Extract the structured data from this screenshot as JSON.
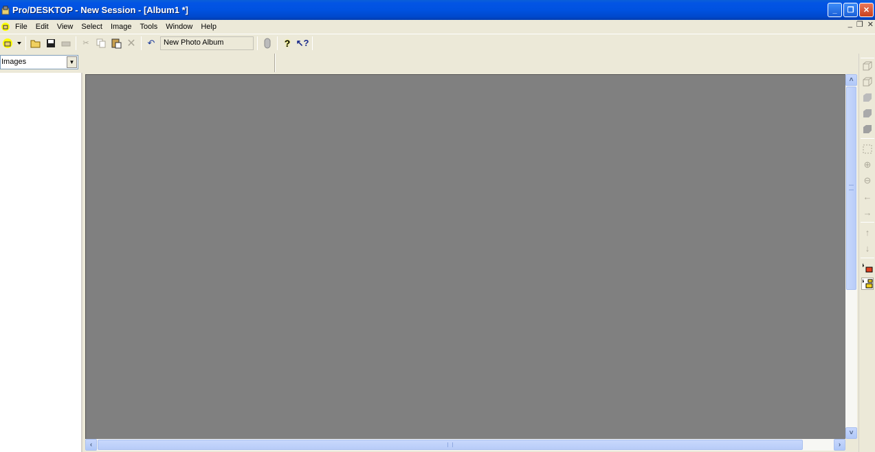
{
  "window": {
    "title": "Pro/DESKTOP - New Session - [Album1 *]",
    "minimize": "_",
    "restore": "❐",
    "close": "✕"
  },
  "menubar": {
    "items": [
      "File",
      "Edit",
      "View",
      "Select",
      "Image",
      "Tools",
      "Window",
      "Help"
    ],
    "mdi": {
      "minimize": "_",
      "restore": "❐",
      "close": "✕"
    }
  },
  "toolbar": {
    "field_value": "New Photo Album",
    "icons": [
      "app-menu-icon",
      "dropdown-arrow-icon",
      "open-folder-icon",
      "save-icon",
      "print-icon",
      "cut-icon",
      "copy-icon",
      "paste-icon",
      "delete-icon",
      "undo-icon",
      "link-icon",
      "help-icon",
      "whats-this-icon"
    ]
  },
  "sidebar": {
    "combo_value": "Images",
    "combo_arrow": "▼"
  },
  "scroll": {
    "up": "˄",
    "down": "˅",
    "left": "‹",
    "right": "›"
  },
  "right_toolbar": {
    "icons": [
      "wireframe-view-icon",
      "hidden-line-view-icon",
      "shaded-view-icon",
      "shaded-edges-view-icon",
      "solid-view-icon",
      "zoom-fit-icon",
      "zoom-in-icon",
      "zoom-out-icon",
      "pan-left-icon",
      "pan-right-icon",
      "pan-up-icon",
      "pan-down-icon",
      "select-object-icon",
      "select-group-icon"
    ]
  }
}
